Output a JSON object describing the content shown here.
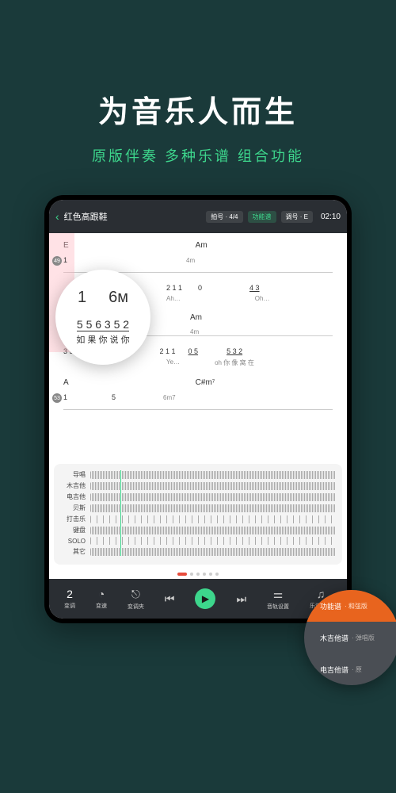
{
  "hero": {
    "title": "为音乐人而生",
    "subtitle": "原版伴奏  多种乐谱  组合功能"
  },
  "header": {
    "song_title": "红色高跟鞋",
    "badge_meter": "拍号 · 4/4",
    "badge_func": "功能谱",
    "badge_key": "调号 · E",
    "time": "02:10"
  },
  "sheet": {
    "chord_e": "E",
    "chord_am": "Am",
    "chord_a": "A",
    "chord_csharp": "C#m⁷",
    "num_49": "49",
    "num_53": "53",
    "marking_4m": "4m",
    "marking_6m7": "6m7",
    "row1_left": "1",
    "row1_right": "3  5·",
    "row1_notes1": "2 1 1",
    "row1_notes2": "0",
    "row1_text1": "Ah…",
    "row1_notes3": "4  3",
    "row1_text2": "Oh…",
    "row2_notes1": "2 1 1",
    "row2_notes2": "0  5",
    "row2_text1": "Ye…",
    "row2_text2": "oh  你  像  窝  在",
    "row2_notes3": "5  3 2",
    "row3_left": "1",
    "row3_right": "5"
  },
  "magnifier": {
    "big1": "1",
    "big2": "6м",
    "mid": "5  5   6  3 5 2",
    "bot": "如 果  你  说 你"
  },
  "tracks": {
    "t1": "导唱",
    "t2": "木吉他",
    "t3": "电吉他",
    "t4": "贝斯",
    "t5": "打击乐",
    "t6": "键盘",
    "t7": "SOLO",
    "t8": "其它"
  },
  "player": {
    "transpose_val": "2",
    "transpose_lbl": "变调",
    "tempo_lbl": "变速",
    "key_lbl": "变调夹",
    "tracks_lbl": "音轨设置",
    "sheet_lbl": "乐谱选择"
  },
  "popup": {
    "r1_main": "功能谱",
    "r1_sub": "· 和弦版",
    "r2_main": "木吉他谱",
    "r2_sub": "· 弹唱版",
    "r3_main": "电吉他谱",
    "r3_sub": "· 原"
  }
}
